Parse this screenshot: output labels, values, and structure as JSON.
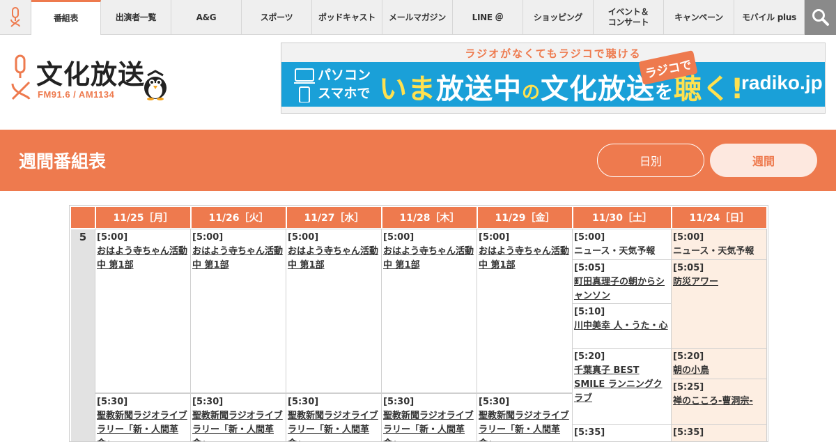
{
  "nav": {
    "items": [
      {
        "label": "番組表",
        "active": true
      },
      {
        "label": "出演者一覧"
      },
      {
        "label": "A&G"
      },
      {
        "label": "スポーツ"
      },
      {
        "label": "ポッドキャスト"
      },
      {
        "label": "メールマガジン"
      },
      {
        "label": "LINE ＠"
      },
      {
        "label": "ショッピング"
      },
      {
        "label": "イベント＆\nコンサート"
      },
      {
        "label": "キャンペーン"
      },
      {
        "label": "モバイル plus"
      }
    ],
    "search_icon": "search-icon",
    "logo_icon": "qr-mascot-logo-icon"
  },
  "header": {
    "logo_text": "文化放送",
    "logo_freq": "FM91.6 / AM1134",
    "banner": {
      "top": "ラジオがなくてもラジコで聴ける",
      "left_line1": "パソコン",
      "left_line2": "スマホで",
      "main_1": "いま",
      "main_2": "放送中",
      "main_3": "の",
      "main_4": "文化放送",
      "main_5": "を",
      "main_6": "聴く!",
      "tag": "ラジコで",
      "brand": "radiko.jp"
    }
  },
  "page": {
    "title": "週間番組表",
    "btn_daily": "日別",
    "btn_weekly": "週間"
  },
  "schedule": {
    "hour": "5",
    "days": [
      "11/25［月］",
      "11/26［火］",
      "11/27［水］",
      "11/28［木］",
      "11/29［金］",
      "11/30［土］",
      "11/24［日］"
    ],
    "weekday_prog_1": {
      "time": "[5:00]",
      "name": "おはよう寺ちゃん活動中 第1部"
    },
    "weekday_prog_2": {
      "time": "[5:30]",
      "name": "聖教新聞ラジオライブラリー「新・人間革命」"
    },
    "sat": [
      {
        "time": "[5:00]",
        "name": "ニュース・天気予報"
      },
      {
        "time": "[5:05]",
        "name": "町田真理子の朝からシャンソン"
      },
      {
        "time": "[5:10]",
        "name": "川中美幸 人・うた・心"
      },
      {
        "time": "[5:20]",
        "name": "千葉真子 BEST SMILE ランニングクラブ"
      },
      {
        "time": "[5:35]",
        "name": ""
      }
    ],
    "sun": [
      {
        "time": "[5:00]",
        "name": "ニュース・天気予報"
      },
      {
        "time": "[5:05]",
        "name": "防災アワー"
      },
      {
        "time": "[5:20]",
        "name": "朝の小鳥"
      },
      {
        "time": "[5:25]",
        "name": "禅のこころ-曹洞宗-"
      },
      {
        "time": "[5:35]",
        "name": ""
      }
    ]
  },
  "colors": {
    "accent": "#ee7a4e",
    "accent_light": "#fde8df",
    "sunday_bg": "#fdeee2",
    "radiko_blue": "#1aa0d8"
  }
}
